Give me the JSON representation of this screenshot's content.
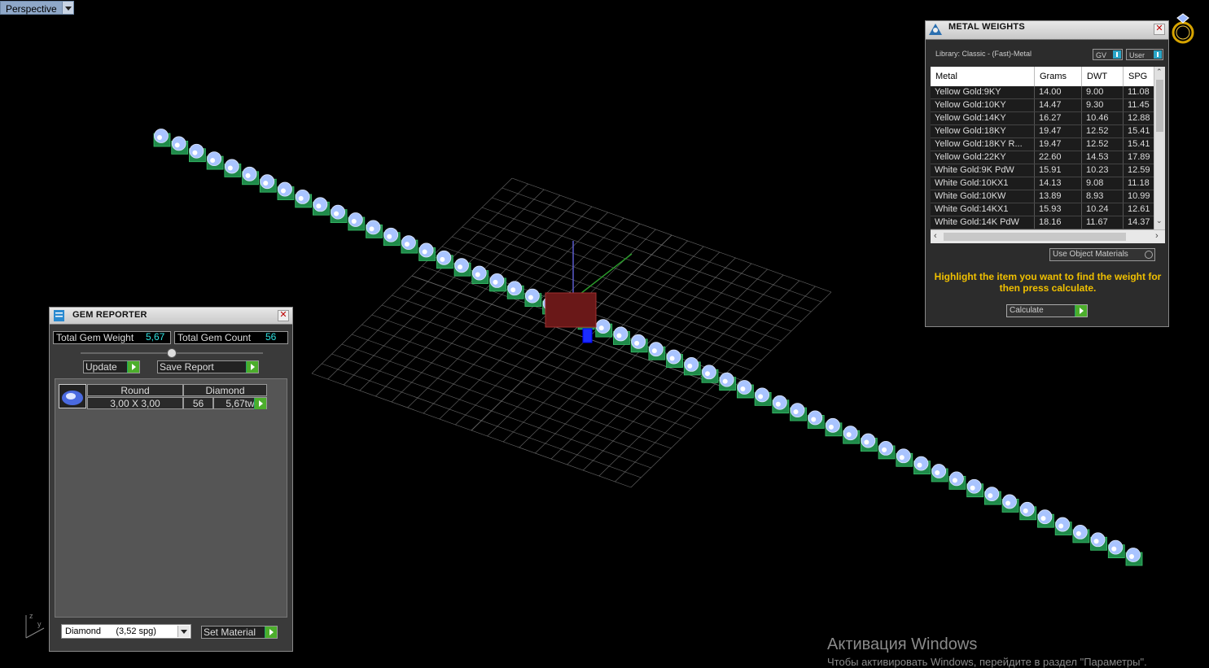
{
  "viewport": {
    "label": "Perspective"
  },
  "metal_weights": {
    "title": "METAL WEIGHTS",
    "library": "Library: Classic - (Fast)-Metal",
    "gv_label": "GV",
    "user_label": "User",
    "columns": [
      "Metal",
      "Grams",
      "DWT",
      "SPG"
    ],
    "rows": [
      [
        "Yellow Gold:9KY",
        "14.00",
        "9.00",
        "11.08"
      ],
      [
        "Yellow Gold:10KY",
        "14.47",
        "9.30",
        "11.45"
      ],
      [
        "Yellow Gold:14KY",
        "16.27",
        "10.46",
        "12.88"
      ],
      [
        "Yellow Gold:18KY",
        "19.47",
        "12.52",
        "15.41"
      ],
      [
        "Yellow Gold:18KY R...",
        "19.47",
        "12.52",
        "15.41"
      ],
      [
        "Yellow Gold:22KY",
        "22.60",
        "14.53",
        "17.89"
      ],
      [
        "White Gold:9K PdW",
        "15.91",
        "10.23",
        "12.59"
      ],
      [
        "White Gold:10KX1",
        "14.13",
        "9.08",
        "11.18"
      ],
      [
        "White Gold:10KW",
        "13.89",
        "8.93",
        "10.99"
      ],
      [
        "White Gold:14KX1",
        "15.93",
        "10.24",
        "12.61"
      ],
      [
        "White Gold:14K PdW",
        "18.16",
        "11.67",
        "14.37"
      ]
    ],
    "use_object_materials": "Use Object Materials",
    "hint": "Highlight the item you want to find the weight for then press calculate.",
    "calculate": "Calculate"
  },
  "gem_reporter": {
    "title": "GEM REPORTER",
    "total_weight_label": "Total Gem Weight",
    "total_weight": "5,67",
    "total_count_label": "Total Gem Count",
    "total_count": "56",
    "update": "Update",
    "save_report": "Save Report",
    "gem": {
      "shape": "Round",
      "material": "Diamond",
      "size": "3,00 X 3,00",
      "count": "56",
      "weight": "5,67tw"
    },
    "material_select": "Diamond      (3,52 spg)",
    "set_material": "Set Material"
  },
  "watermark": {
    "line1": "Активация Windows",
    "line2": "Чтобы активировать Windows, перейдите в раздел \"Параметры\"."
  },
  "colors": {
    "gem": "#a9c4ff",
    "setting": "#1f8a4a",
    "grid": "#888888",
    "accent": "#2ee0e0",
    "hint": "#f0c000"
  }
}
